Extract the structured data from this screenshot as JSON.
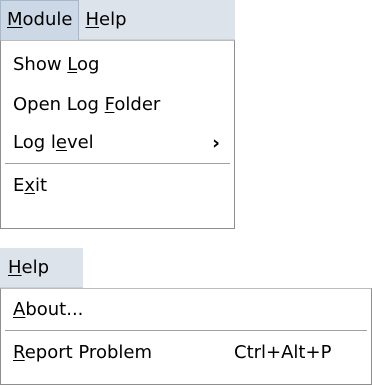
{
  "module_menu": {
    "menubar": [
      {
        "pre": "",
        "key": "M",
        "post": "odule"
      },
      {
        "pre": "",
        "key": "H",
        "post": "elp"
      }
    ],
    "items": [
      {
        "pre": "Show ",
        "key": "L",
        "post": "og"
      },
      {
        "pre": "Open Log ",
        "key": "F",
        "post": "older"
      },
      {
        "pre": "Log l",
        "key": "e",
        "post": "vel",
        "submenu_arrow": "›"
      },
      {
        "pre": "E",
        "key": "x",
        "post": "it"
      }
    ]
  },
  "help_menu": {
    "menubar": [
      {
        "pre": "",
        "key": "H",
        "post": "elp"
      }
    ],
    "items": [
      {
        "pre": "",
        "key": "A",
        "post": "bout..."
      },
      {
        "pre": "",
        "key": "R",
        "post": "eport Problem",
        "shortcut": "Ctrl+Alt+P"
      }
    ]
  },
  "colors": {
    "menubar_bg": "#dce3ea",
    "open_menu_bg": "#ccd8e6",
    "dropdown_bg": "#ffffff",
    "separator": "#a0a0a0"
  }
}
